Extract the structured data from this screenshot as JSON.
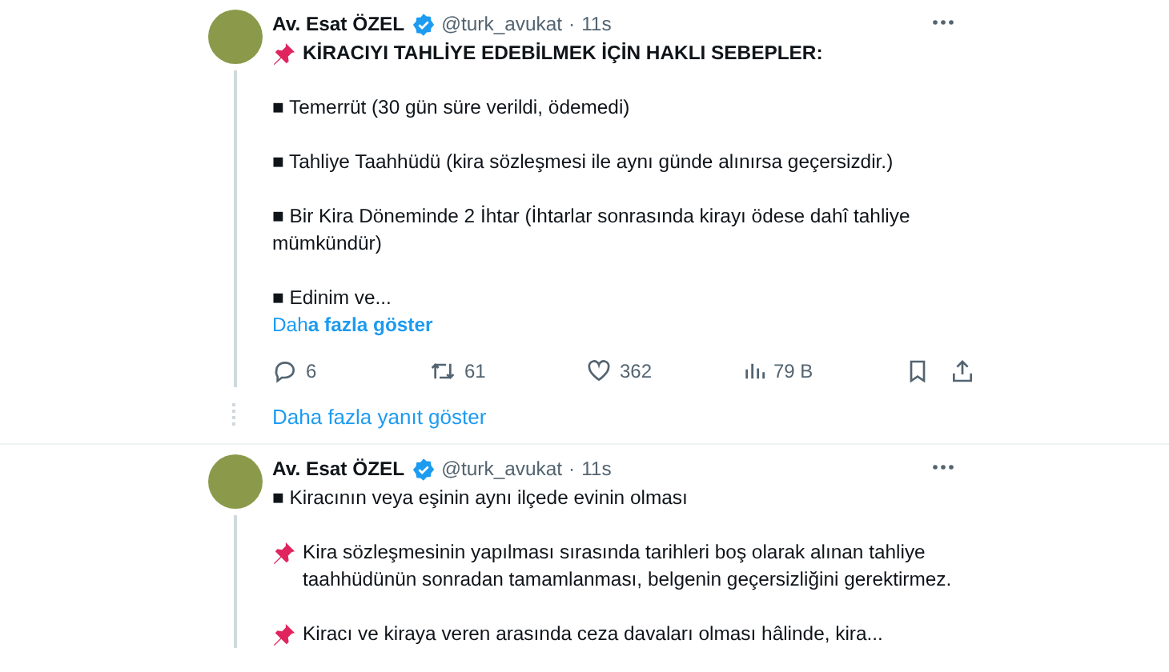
{
  "tweets": [
    {
      "author": "Av. Esat ÖZEL",
      "verified": true,
      "handle": "@turk_avukat",
      "separator": "·",
      "time": "11s",
      "paragraphs": [
        {
          "kind": "pin",
          "text": "KİRACIYI TAHLİYE EDEBİLMEK İÇİN HAKLI SEBEPLER:",
          "bold": true
        },
        {
          "kind": "plain",
          "text": "■ Temerrüt (30 gün süre verildi, ödemedi)",
          "bold": false
        },
        {
          "kind": "plain",
          "text": "■ Tahliye Taahhüdü (kira sözleşmesi ile aynı günde alınırsa geçersizdir.)",
          "bold": false
        },
        {
          "kind": "plain",
          "text": "■ Bir Kira Döneminde 2 İhtar (İhtarlar sonrasında kirayı ödese dahî tahliye mümkündür)",
          "bold": false
        },
        {
          "kind": "plain",
          "text": "■ Edinim ve...",
          "bold": false
        }
      ],
      "show_more": "Dah**a fazla göster**",
      "actions": [
        {
          "kind": "reply",
          "count": "6"
        },
        {
          "kind": "repost",
          "count": "61"
        },
        {
          "kind": "like",
          "count": "362"
        },
        {
          "kind": "views",
          "count": "79 B"
        },
        {
          "kind": "bookmark"
        },
        {
          "kind": "share"
        }
      ]
    },
    {
      "author": "Av. Esat ÖZEL",
      "verified": true,
      "handle": "@turk_avukat",
      "separator": "·",
      "time": "11s",
      "paragraphs": [
        {
          "kind": "plain",
          "text": "■ Kiracının veya eşinin aynı ilçede evinin olması",
          "bold": false
        },
        {
          "kind": "pin",
          "text": "Kira sözleşmesinin yapılması sırasında tarihleri boş olarak alınan tahliye taahhüdünün sonradan tamamlanması, belgenin geçersizliğini gerektirmez.",
          "bold": false
        },
        {
          "kind": "pin",
          "text": "Kiracı ve kiraya veren arasında ceza davaları olması hâlinde, kira...",
          "bold": false
        }
      ]
    }
  ],
  "more_replies": "Daha fazla yanıt göster"
}
